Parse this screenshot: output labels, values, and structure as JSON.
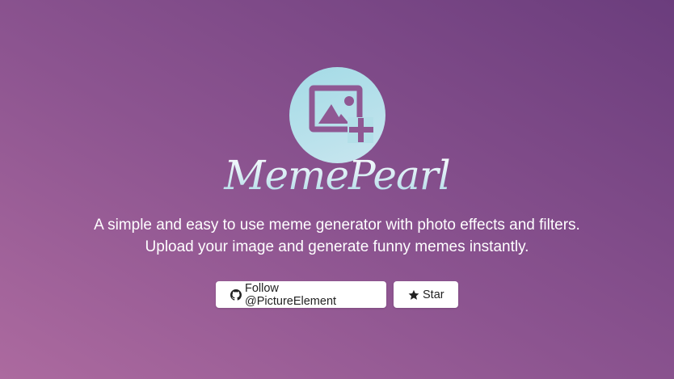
{
  "app": {
    "brand_name": "MemePearl",
    "logo_icon": "image-add-icon",
    "tagline_line1": "A simple and easy to use meme generator with photo effects and filters.",
    "tagline_line2": "Upload your image and generate funny memes instantly."
  },
  "buttons": {
    "follow_label": "Follow @PictureElement",
    "follow_icon": "github-icon",
    "star_label": "Star",
    "star_icon": "star-icon"
  },
  "colors": {
    "background_start": "#ac6a9f",
    "background_end": "#6b3d7d",
    "logo_circle": "#b3dfe8",
    "logo_stroke": "#8c5490",
    "button_bg": "#ffffff",
    "button_text": "#222222"
  }
}
